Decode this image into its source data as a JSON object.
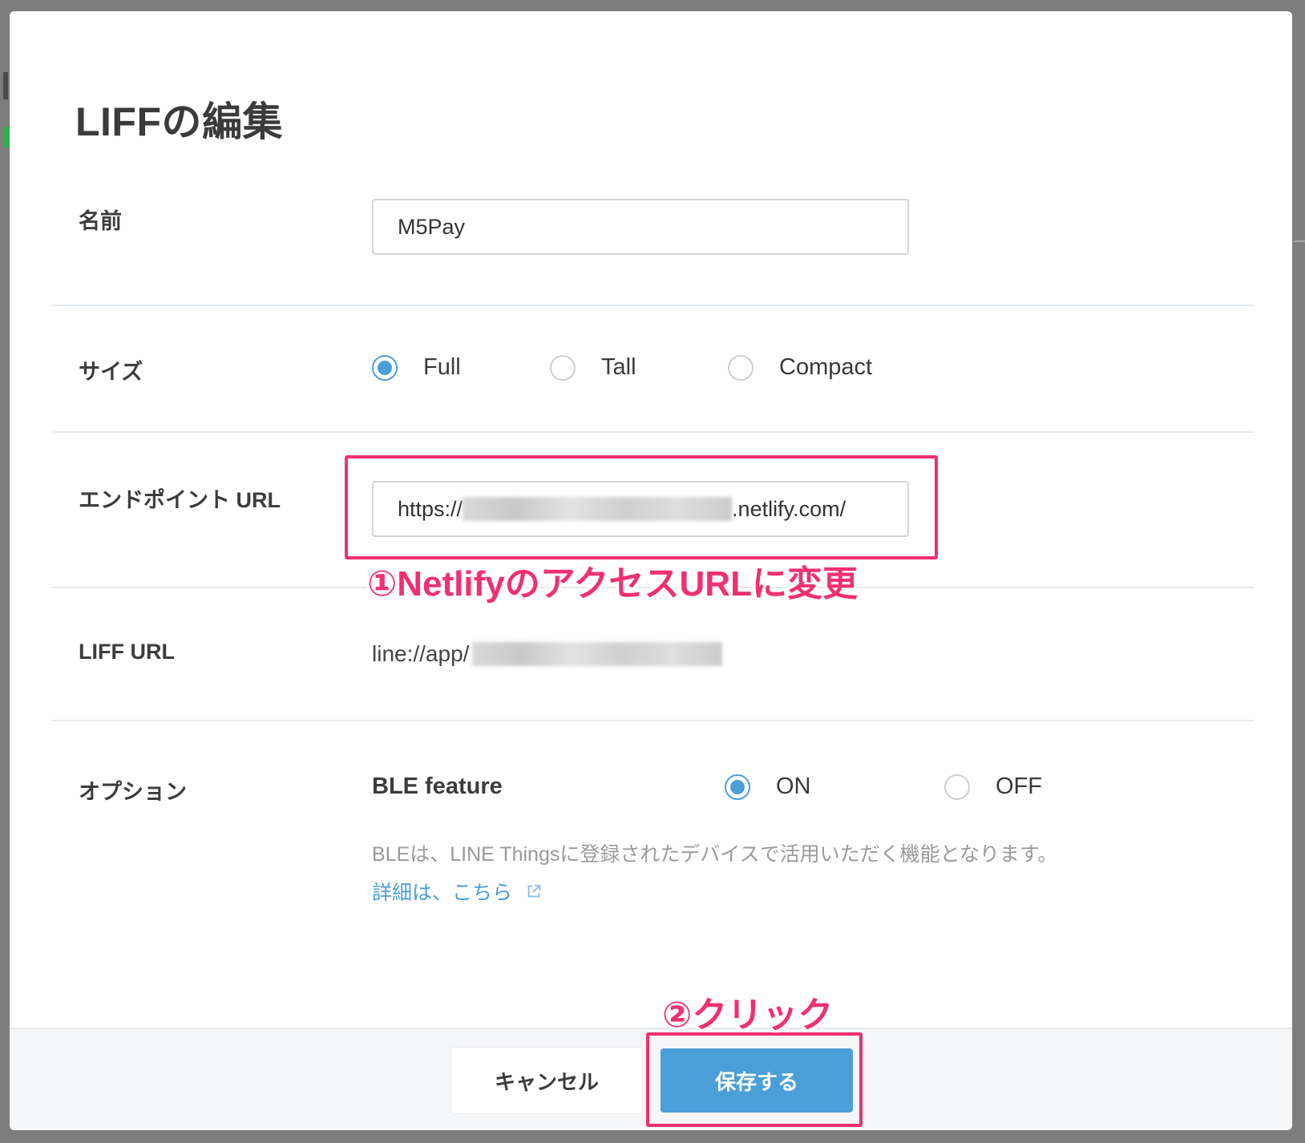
{
  "dialog": {
    "title": "LIFFの編集"
  },
  "name_row": {
    "label": "名前",
    "value": "M5Pay"
  },
  "size_row": {
    "label": "サイズ",
    "options": [
      {
        "label": "Full",
        "checked": true
      },
      {
        "label": "Tall",
        "checked": false
      },
      {
        "label": "Compact",
        "checked": false
      }
    ]
  },
  "endpoint_row": {
    "label": "エンドポイント URL",
    "value_prefix": "https://",
    "value_suffix": ".netlify.com/"
  },
  "liff_url_row": {
    "label": "LIFF URL",
    "value_prefix": "line://app/"
  },
  "options_row": {
    "label": "オプション",
    "ble_label": "BLE feature",
    "ble_options": [
      {
        "label": "ON",
        "checked": true
      },
      {
        "label": "OFF",
        "checked": false
      }
    ],
    "help_text": "BLEは、LINE Thingsに登録されたデバイスで活用いただく機能となります。",
    "help_link": "詳細は、こちら"
  },
  "footer": {
    "cancel_label": "キャンセル",
    "save_label": "保存する"
  },
  "annotations": {
    "step1": "①NetlifyのアクセスURLに変更",
    "step2": "②クリック",
    "color": "#f0306f"
  },
  "colors": {
    "accent": "#4a9fd8"
  }
}
